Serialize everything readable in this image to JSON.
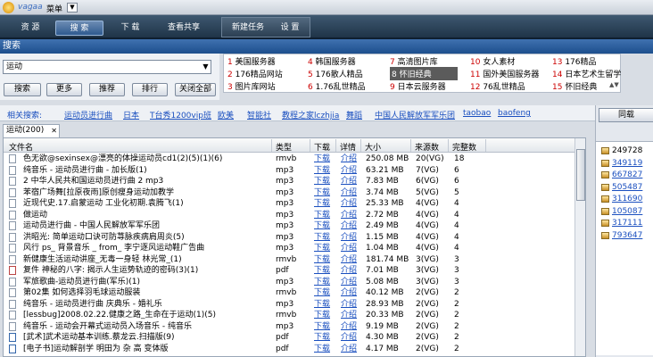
{
  "titlebar": {
    "app_name": "vagaa",
    "menu_label": "菜单"
  },
  "nav": {
    "tabs": [
      "资 源",
      "搜 索",
      "下 载",
      "查看共享"
    ],
    "sub": [
      "新建任务",
      "设 置"
    ]
  },
  "header": {
    "title": "搜索"
  },
  "search": {
    "query": "运动",
    "buttons": [
      "搜索",
      "更多",
      "推荐",
      "排行",
      "关闭全部"
    ]
  },
  "hot": {
    "items": [
      {
        "n": "1",
        "label": "美国服务器"
      },
      {
        "n": "4",
        "label": "韩国服务器"
      },
      {
        "n": "7",
        "label": "高清图片库"
      },
      {
        "n": "10",
        "label": "女人素材"
      },
      {
        "n": "13",
        "label": "176精品"
      },
      {
        "n": "2",
        "label": "176精品网站"
      },
      {
        "n": "5",
        "label": "176散人精品"
      },
      {
        "n": "8",
        "label": "怀旧经典"
      },
      {
        "n": "11",
        "label": "国外美国服务器"
      },
      {
        "n": "14",
        "label": "日本艺术生留学"
      },
      {
        "n": "3",
        "label": "图片库网站"
      },
      {
        "n": "6",
        "label": "1.76乱世精品"
      },
      {
        "n": "9",
        "label": "日本云服务器"
      },
      {
        "n": "12",
        "label": "76乱世精品"
      },
      {
        "n": "15",
        "label": "怀旧经典"
      }
    ]
  },
  "related": {
    "label": "相关搜索:",
    "items": [
      "运动员进行曲",
      "日本",
      "T台秀1200vip班",
      "欧美",
      "智能社",
      "教程之家lczhjia",
      "舞蹈",
      "中国人民解放军军乐团",
      "taobao",
      "baofeng"
    ]
  },
  "results": {
    "tab_label": "运动(200)",
    "columns": [
      "文件名",
      "类型",
      "下载",
      "详情",
      "大小",
      "来源数",
      "完整数"
    ],
    "rows": [
      {
        "icon": "file",
        "name": "色无欲@sexinsex@漂亮的体操运动员cd1(2)(5)(1)(6)",
        "type": "rmvb",
        "dl": "下载",
        "det": "介绍",
        "size": "250.08 MB",
        "src": "20(VG)",
        "full": "18"
      },
      {
        "icon": "file",
        "name": "纯音乐 - 运动员进行曲 - 加长版(1)",
        "type": "mp3",
        "dl": "下载",
        "det": "介绍",
        "size": "63.21 MB",
        "src": "7(VG)",
        "full": "6"
      },
      {
        "icon": "file",
        "name": "2 中华人民共和国运动员进行曲 2 mp3",
        "type": "mp3",
        "dl": "下载",
        "det": "介绍",
        "size": "7.83 MB",
        "src": "6(VG)",
        "full": "6"
      },
      {
        "icon": "file",
        "name": "苯宿广场舞[拉原夜雨]原创瘦身运动加教学",
        "type": "mp3",
        "dl": "下载",
        "det": "介绍",
        "size": "3.74 MB",
        "src": "5(VG)",
        "full": "5"
      },
      {
        "icon": "file",
        "name": "近现代史.17.启蒙运动 工业化初期.袁腾飞(1)",
        "type": "mp3",
        "dl": "下载",
        "det": "介绍",
        "size": "25.33 MB",
        "src": "4(VG)",
        "full": "4"
      },
      {
        "icon": "file",
        "name": "做运动",
        "type": "mp3",
        "dl": "下载",
        "det": "介绍",
        "size": "2.72 MB",
        "src": "4(VG)",
        "full": "4"
      },
      {
        "icon": "file",
        "name": "运动员进行曲 - 中国人民解放军军乐团",
        "type": "mp3",
        "dl": "下载",
        "det": "介绍",
        "size": "2.49 MB",
        "src": "4(VG)",
        "full": "4"
      },
      {
        "icon": "file",
        "name": "洪昭光: 简单运动口诀可防荨脉疾病肩周炎(5)",
        "type": "mp3",
        "dl": "下载",
        "det": "介绍",
        "size": "1.15 MB",
        "src": "4(VG)",
        "full": "4"
      },
      {
        "icon": "file",
        "name": "风行 ps_ 背景音乐 _ from_ 李宁逐风运动鞋广告曲",
        "type": "mp3",
        "dl": "下载",
        "det": "介绍",
        "size": "1.04 MB",
        "src": "4(VG)",
        "full": "4"
      },
      {
        "icon": "file",
        "name": "新健康生活运动讲座_无毒一身轻 林光常_(1)",
        "type": "rmvb",
        "dl": "下载",
        "det": "介绍",
        "size": "181.74 MB",
        "src": "3(VG)",
        "full": "3"
      },
      {
        "icon": "pdf",
        "name": "复件 神秘的八字: 揭示人生运势轨迹的密码(3)(1)",
        "type": "pdf",
        "dl": "下载",
        "det": "介绍",
        "size": "7.01 MB",
        "src": "3(VG)",
        "full": "3"
      },
      {
        "icon": "file",
        "name": "军旅歌曲-运动员进行曲(军乐)(1)",
        "type": "mp3",
        "dl": "下载",
        "det": "介绍",
        "size": "5.08 MB",
        "src": "3(VG)",
        "full": "3"
      },
      {
        "icon": "file",
        "name": "第02集 如何选择羽毛球运动服装",
        "type": "rmvb",
        "dl": "下载",
        "det": "介绍",
        "size": "40.12 MB",
        "src": "2(VG)",
        "full": "2"
      },
      {
        "icon": "file",
        "name": "纯音乐 - 运动员进行曲 庆典乐 - 婚礼乐",
        "type": "mp3",
        "dl": "下载",
        "det": "介绍",
        "size": "28.93 MB",
        "src": "2(VG)",
        "full": "2"
      },
      {
        "icon": "file",
        "name": "[lessbug]2008.02.22.健康之路_生命在于运动(1)(5)",
        "type": "rmvb",
        "dl": "下载",
        "det": "介绍",
        "size": "20.33 MB",
        "src": "2(VG)",
        "full": "2"
      },
      {
        "icon": "file",
        "name": "纯音乐 - 运动会开幕式运动员入场音乐 - 纯音乐",
        "type": "mp3",
        "dl": "下载",
        "det": "介绍",
        "size": "9.19 MB",
        "src": "2(VG)",
        "full": "2"
      },
      {
        "icon": "doc",
        "name": "[武术]武术运动基本训练.蔡龙云.扫描版(9)",
        "type": "pdf",
        "dl": "下载",
        "det": "介绍",
        "size": "4.30 MB",
        "src": "2(VG)",
        "full": "2"
      },
      {
        "icon": "doc",
        "name": "[电子书]运动解剖学 明田为 杂 高 变体版",
        "type": "pdf",
        "dl": "下载",
        "det": "介绍",
        "size": "4.17 MB",
        "src": "2(VG)",
        "full": "2"
      }
    ]
  },
  "side": {
    "button": "同载",
    "items": [
      "249728",
      "349119",
      "667827",
      "505487",
      "311690",
      "105087",
      "317111",
      "793647"
    ]
  }
}
